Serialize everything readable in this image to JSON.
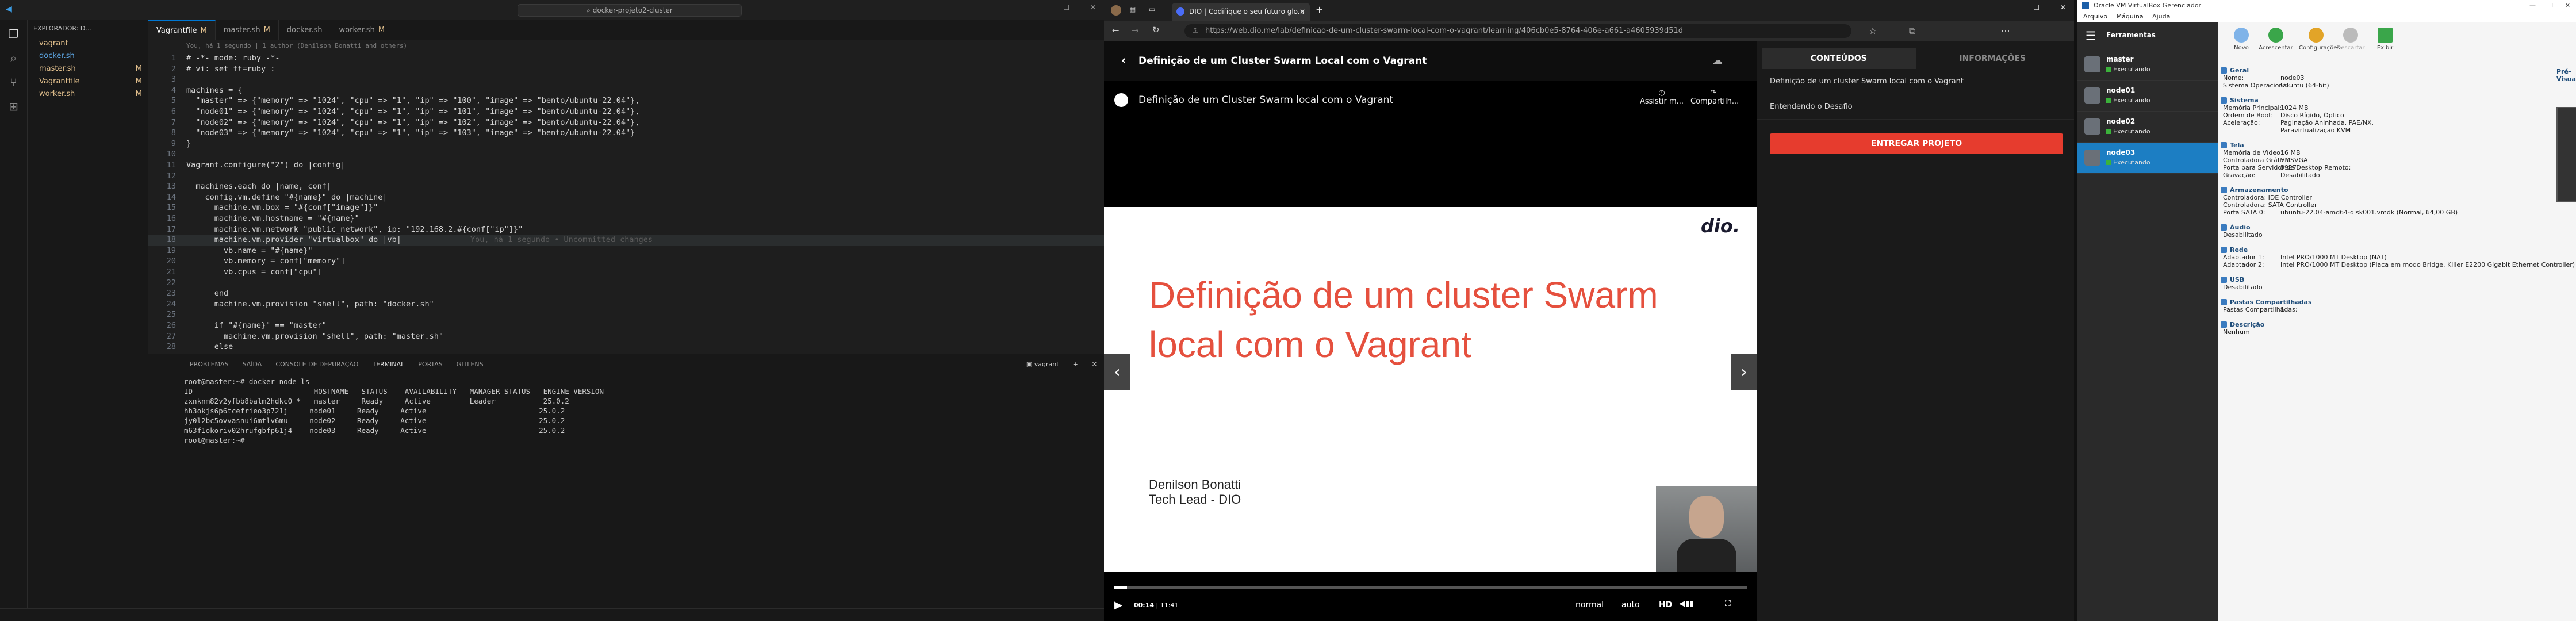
{
  "vscode": {
    "search": "docker-projeto2-cluster",
    "explorer_title": "EXPLORADOR: D...",
    "files": [
      {
        "name": "vagrant",
        "mod": ""
      },
      {
        "name": "docker.sh",
        "mod": ""
      },
      {
        "name": "master.sh",
        "mod": "M"
      },
      {
        "name": "Vagrantfile",
        "mod": "M"
      },
      {
        "name": "worker.sh",
        "mod": "M"
      }
    ],
    "tabs": [
      {
        "label": "Vagrantfile",
        "mod": "M"
      },
      {
        "label": "master.sh",
        "mod": "M"
      },
      {
        "label": "docker.sh",
        "mod": ""
      },
      {
        "label": "worker.sh",
        "mod": "M"
      }
    ],
    "blame": "You, há 1 segundo | 1 author (Denilson Bonatti and others)",
    "code_lines": [
      {
        "n": "1",
        "t": "# -*- mode: ruby -*-"
      },
      {
        "n": "2",
        "t": "# vi: set ft=ruby :"
      },
      {
        "n": "3",
        "t": ""
      },
      {
        "n": "4",
        "t": "machines = {"
      },
      {
        "n": "5",
        "t": "  \"master\" => {\"memory\" => \"1024\", \"cpu\" => \"1\", \"ip\" => \"100\", \"image\" => \"bento/ubuntu-22.04\"},"
      },
      {
        "n": "6",
        "t": "  \"node01\" => {\"memory\" => \"1024\", \"cpu\" => \"1\", \"ip\" => \"101\", \"image\" => \"bento/ubuntu-22.04\"},"
      },
      {
        "n": "7",
        "t": "  \"node02\" => {\"memory\" => \"1024\", \"cpu\" => \"1\", \"ip\" => \"102\", \"image\" => \"bento/ubuntu-22.04\"},"
      },
      {
        "n": "8",
        "t": "  \"node03\" => {\"memory\" => \"1024\", \"cpu\" => \"1\", \"ip\" => \"103\", \"image\" => \"bento/ubuntu-22.04\"}"
      },
      {
        "n": "9",
        "t": "}"
      },
      {
        "n": "10",
        "t": ""
      },
      {
        "n": "11",
        "t": "Vagrant.configure(\"2\") do |config|"
      },
      {
        "n": "12",
        "t": ""
      },
      {
        "n": "13",
        "t": "  machines.each do |name, conf|"
      },
      {
        "n": "14",
        "t": "    config.vm.define \"#{name}\" do |machine|"
      },
      {
        "n": "15",
        "t": "      machine.vm.box = \"#{conf[\"image\"]}\""
      },
      {
        "n": "16",
        "t": "      machine.vm.hostname = \"#{name}\""
      },
      {
        "n": "17",
        "t": "      machine.vm.network \"public_network\", ip: \"192.168.2.#{conf[\"ip\"]}\""
      },
      {
        "n": "18",
        "t": "      machine.vm.provider \"virtualbox\" do |vb|"
      },
      {
        "n": "19",
        "t": "        vb.name = \"#{name}\""
      },
      {
        "n": "20",
        "t": "        vb.memory = conf[\"memory\"]"
      },
      {
        "n": "21",
        "t": "        vb.cpus = conf[\"cpu\"]"
      },
      {
        "n": "22",
        "t": ""
      },
      {
        "n": "23",
        "t": "      end"
      },
      {
        "n": "24",
        "t": "      machine.vm.provision \"shell\", path: \"docker.sh\""
      },
      {
        "n": "25",
        "t": ""
      },
      {
        "n": "26",
        "t": "      if \"#{name}\" == \"master\""
      },
      {
        "n": "27",
        "t": "        machine.vm.provision \"shell\", path: \"master.sh\""
      },
      {
        "n": "28",
        "t": "      else"
      }
    ],
    "inline_hint": "You, há 1 segundo • Uncommitted changes",
    "panel_tabs": [
      "PROBLEMAS",
      "SAÍDA",
      "CONSOLE DE DEPURAÇÃO",
      "TERMINAL",
      "PORTAS",
      "GITLENS"
    ],
    "active_panel": "TERMINAL",
    "terminal_name": "vagrant",
    "terminal_lines": [
      "root@master:~# docker node ls",
      "ID                            HOSTNAME   STATUS    AVAILABILITY   MANAGER STATUS   ENGINE VERSION",
      "zxnknm82v2yfbb8balm2hdkc0 *   master     Ready     Active         Leader           25.0.2",
      "hh3okjs6p6tcefrieo3p721j     node01     Ready     Active                          25.0.2",
      "jy0l2bc5ovvasnui6mtlv6mu     node02     Ready     Active                          25.0.2",
      "m63f1okoriv02hrufgbfp61j4    node03     Ready     Active                          25.0.2",
      "root@master:~# "
    ]
  },
  "browser": {
    "tab_title": "DIO | Codifique o seu futuro glo...",
    "url": "https://web.dio.me/lab/definicao-de-um-cluster-swarm-local-com-o-vagrant/learning/406cb0e5-8764-406e-a661-a4605939d51d",
    "course_title": "Definição de um Cluster Swarm Local com o Vagrant",
    "video_title": "Definição de um Cluster Swarm local com o Vagrant",
    "watch_label": "Assistir m...",
    "share_label": "Compartilh...",
    "slide_logo": "dio.",
    "slide_title": "Definição de um cluster Swarm local com o Vagrant",
    "author_name": "Denilson Bonatti",
    "author_role": "Tech Lead - DIO",
    "time_current": "00:14",
    "time_total": "11:41",
    "progress": 0.02,
    "speed_label": "normal",
    "quality_label": "auto",
    "hd_label": "HD",
    "side_tabs": [
      "CONTEÚDOS",
      "INFORMAÇÕES"
    ],
    "active_side_tab": "CONTEÚDOS",
    "side_items": [
      "Definição de um cluster Swarm local com o Vagrant",
      "Entendendo o Desafio"
    ],
    "deliver_button": "ENTREGAR PROJETO"
  },
  "vbox": {
    "title": "Oracle VM VirtualBox Gerenciador",
    "menu": [
      "Arquivo",
      "Máquina",
      "Ajuda"
    ],
    "tools_label": "Ferramentas",
    "vms": [
      {
        "name": "master",
        "state": "Executando"
      },
      {
        "name": "node01",
        "state": "Executando"
      },
      {
        "name": "node02",
        "state": "Executando"
      },
      {
        "name": "node03",
        "state": "Executando"
      }
    ],
    "selected_vm": 3,
    "toolbar": [
      "Novo",
      "Acrescentar",
      "Configurações",
      "Descartar",
      "Exibir"
    ],
    "preview_label": "Pré-Visualização",
    "sections": [
      {
        "title": "Geral",
        "rows": [
          [
            "Nome:",
            "node03"
          ],
          [
            "Sistema Operacional:",
            "Ubuntu (64-bit)"
          ]
        ]
      },
      {
        "title": "Sistema",
        "rows": [
          [
            "Memória Principal:",
            "1024 MB"
          ],
          [
            "Ordem de Boot:",
            "Disco Rígido, Óptico"
          ],
          [
            "Aceleração:",
            "Paginação Aninhada, PAE/NX,"
          ],
          [
            "",
            "Paravirtualização KVM"
          ]
        ]
      },
      {
        "title": "Tela",
        "rows": [
          [
            "Memória de Vídeo:",
            "16 MB"
          ],
          [
            "Controladora Gráfica:",
            "VMSVGA"
          ],
          [
            "Porta para Servidor de Desktop Remoto:",
            "5927"
          ],
          [
            "Gravação:",
            "Desabilitado"
          ]
        ]
      },
      {
        "title": "Armazenamento",
        "rows": [
          [
            "Controladora: IDE Controller",
            ""
          ],
          [
            "Controladora: SATA Controller",
            ""
          ],
          [
            "  Porta SATA 0:",
            "ubuntu-22.04-amd64-disk001.vmdk (Normal, 64,00 GB)"
          ]
        ]
      },
      {
        "title": "Áudio",
        "rows": [
          [
            "Desabilitado",
            ""
          ]
        ]
      },
      {
        "title": "Rede",
        "rows": [
          [
            "Adaptador 1:",
            "Intel PRO/1000 MT Desktop (NAT)"
          ],
          [
            "Adaptador 2:",
            "Intel PRO/1000 MT Desktop (Placa em modo Bridge, Killer E2200 Gigabit Ethernet Controller)"
          ]
        ]
      },
      {
        "title": "USB",
        "rows": [
          [
            "Desabilitado",
            ""
          ]
        ]
      },
      {
        "title": "Pastas Compartilhadas",
        "rows": [
          [
            "Pastas Compartilhadas:",
            "1"
          ]
        ]
      },
      {
        "title": "Descrição",
        "rows": [
          [
            "Nenhum",
            ""
          ]
        ]
      }
    ]
  }
}
